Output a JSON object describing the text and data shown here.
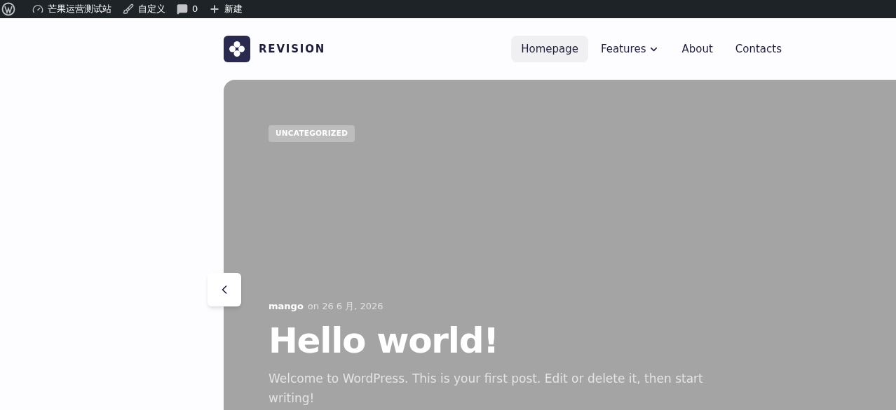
{
  "admin_bar": {
    "site_name": "芒果运营测试站",
    "customize": "自定义",
    "comments_count": "0",
    "new": "新建"
  },
  "header": {
    "logo_text": "REVISION",
    "nav": [
      {
        "label": "Homepage",
        "selected": true,
        "has_dropdown": false
      },
      {
        "label": "Features",
        "selected": false,
        "has_dropdown": true
      },
      {
        "label": "About",
        "selected": false,
        "has_dropdown": false
      },
      {
        "label": "Contacts",
        "selected": false,
        "has_dropdown": false
      }
    ]
  },
  "hero": {
    "category": "UNCATEGORIZED",
    "author": "mango",
    "date": "on 26 6 月, 2026",
    "title": "Hello world!",
    "excerpt": "Welcome to WordPress. This is your first post. Edit or delete it, then start writing!"
  }
}
